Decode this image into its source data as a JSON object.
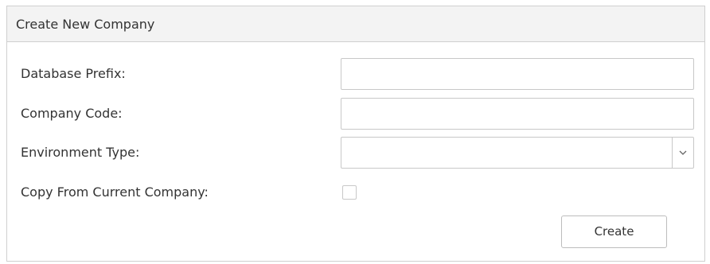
{
  "panel": {
    "title": "Create New Company"
  },
  "form": {
    "database_prefix": {
      "label": "Database Prefix:",
      "value": ""
    },
    "company_code": {
      "label": "Company Code:",
      "value": ""
    },
    "environment_type": {
      "label": "Environment Type:",
      "selected": "",
      "icon": "chevron-down-icon"
    },
    "copy_from_current": {
      "label": "Copy From Current Company:",
      "checked": false
    },
    "create_button": {
      "label": "Create"
    }
  },
  "colors": {
    "header_bg": "#f3f3f3",
    "border": "#cfcfcf",
    "input_border": "#c8c8c8",
    "text": "#333333"
  }
}
